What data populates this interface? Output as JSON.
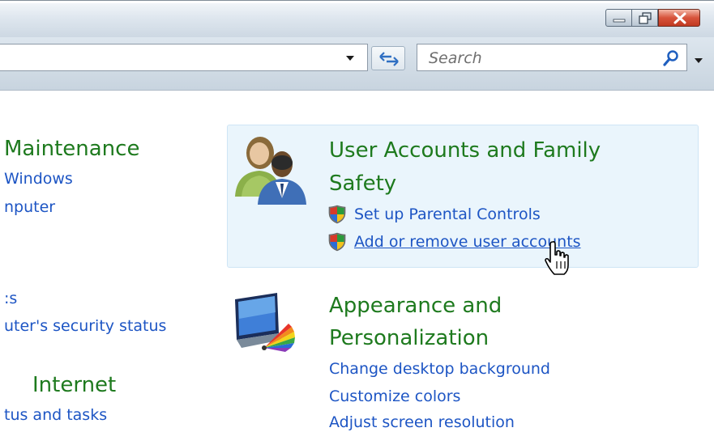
{
  "search": {
    "placeholder": "Search"
  },
  "left_column": {
    "system_title": "Maintenance",
    "system_links": [
      "Windows",
      "nputer"
    ],
    "security_links": [
      ":s",
      "uter's security status"
    ],
    "network_title": "Internet",
    "network_links": [
      "tus and tasks"
    ]
  },
  "user_accounts": {
    "title_line1": "User Accounts and Family",
    "title_line2": "Safety",
    "links": [
      "Set up Parental Controls",
      "Add or remove user accounts"
    ]
  },
  "appearance": {
    "title_line1": "Appearance and",
    "title_line2": "Personalization",
    "links": [
      "Change desktop background",
      "Customize colors",
      "Adjust screen resolution"
    ]
  },
  "colors": {
    "category_title": "#1e7a1e",
    "link": "#1d55c4",
    "highlight": "#eaf5fc"
  }
}
